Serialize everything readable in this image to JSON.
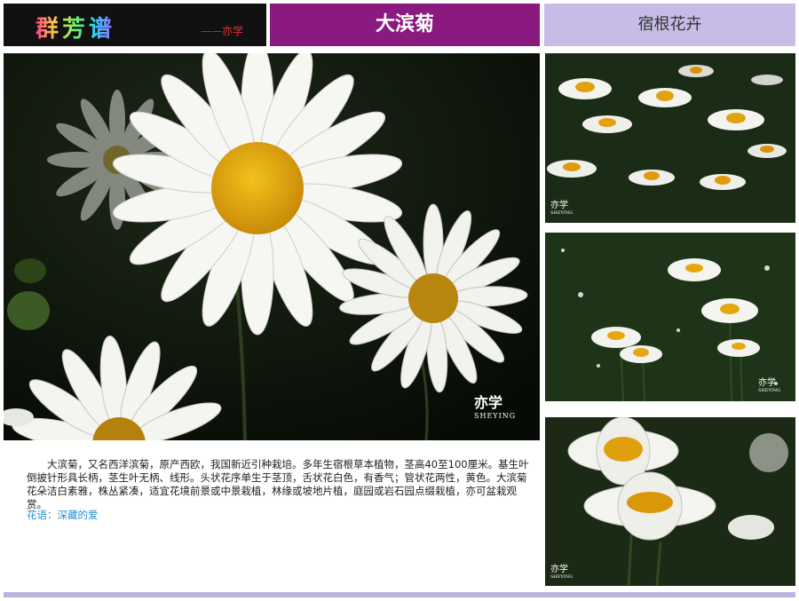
{
  "header": {
    "logo_text": "群芳谱",
    "author_signature": "——亦学",
    "title": "大滨菊",
    "category": "宿根花卉"
  },
  "watermark": {
    "name": "亦学",
    "sub": "SHEYING"
  },
  "description": {
    "body": "大滨菊，又名西洋滨菊，原产西欧，我国新近引种栽培。多年生宿根草本植物，茎高40至100厘米。基生叶倒披针形具长柄，茎生叶无柄、线形。头状花序单生于茎顶，舌状花白色，有香气；管状花两性，黄色。大滨菊花朵洁白素雅，株丛紧凑，适宜花境前景或中景栽植，林缘或坡地片植，庭园或岩石园点缀栽植，亦可盆栽观赏。",
    "flower_language": "花语：深藏的爱"
  },
  "colors": {
    "title_bar": "#8a1a80",
    "category_bar": "#c6bce6",
    "flower_language": "#2a8fd1",
    "petal": "#f4f4f0",
    "flower_center": "#e8a810"
  }
}
